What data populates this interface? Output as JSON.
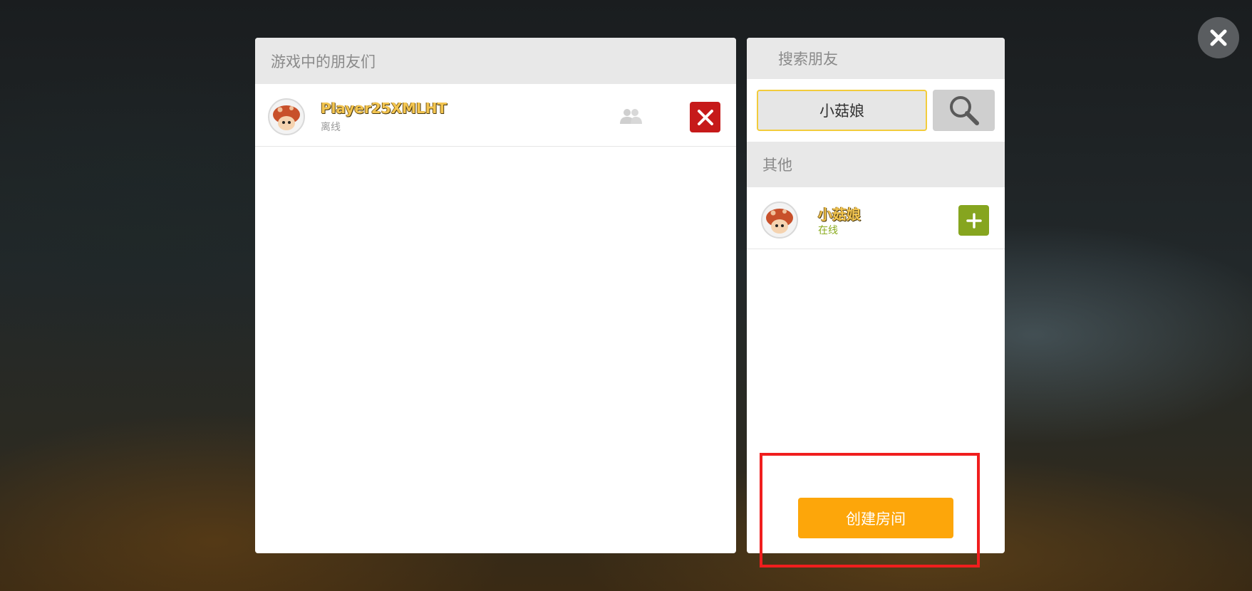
{
  "close_icon": "close-icon",
  "friends_panel": {
    "title": "游戏中的朋友们",
    "friends": [
      {
        "name": "Player25XMLHT",
        "status": "离线",
        "status_color": "#9a9a9a",
        "avatar_icon": "mushroom-avatar-icon",
        "invite_icon": "party-icon",
        "remove_icon": "remove-icon"
      }
    ]
  },
  "search_panel": {
    "title": "搜索朋友",
    "search_value": "小菇娘",
    "search_icon": "magnifier-icon",
    "section_title": "其他",
    "results": [
      {
        "name": "小菇娘",
        "status": "在线",
        "status_color": "#8aab1e",
        "avatar_icon": "mushroom-avatar-icon",
        "add_icon": "plus-icon"
      }
    ],
    "create_room_label": "创建房间"
  },
  "colors": {
    "accent_orange": "#fda60a",
    "remove_red": "#c61a1a",
    "add_green": "#86a51f",
    "name_gold": "#f3c550",
    "highlight_red": "#f01e1e"
  }
}
